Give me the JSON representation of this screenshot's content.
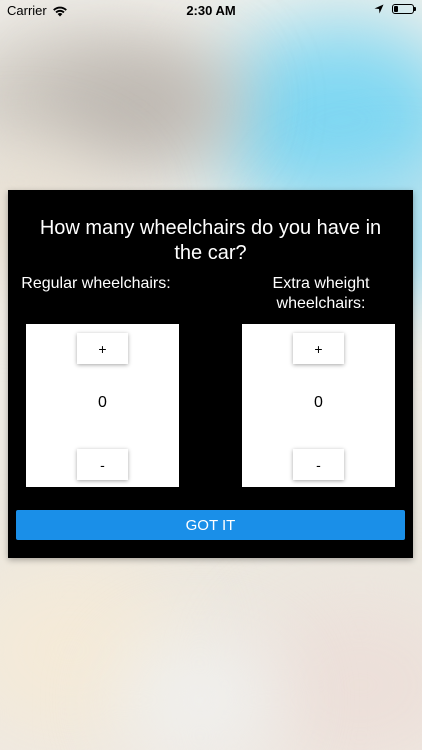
{
  "status_bar": {
    "carrier": "Carrier",
    "time": "2:30 AM",
    "battery_level": 0.2
  },
  "dialog": {
    "title": "How many wheelchairs do you have in the car?",
    "regular": {
      "label": "Regular wheelchairs:",
      "plus_label": "+",
      "value": "0",
      "minus_label": "-"
    },
    "extra": {
      "label": "Extra wheight wheelchairs:",
      "plus_label": "+",
      "value": "0",
      "minus_label": "-"
    },
    "confirm_label": "GOT IT"
  },
  "colors": {
    "dialog_background": "#000000",
    "confirm_button": "#1a8fe8"
  },
  "icons": [
    "wifi-icon",
    "location-arrow-icon",
    "battery-icon"
  ]
}
